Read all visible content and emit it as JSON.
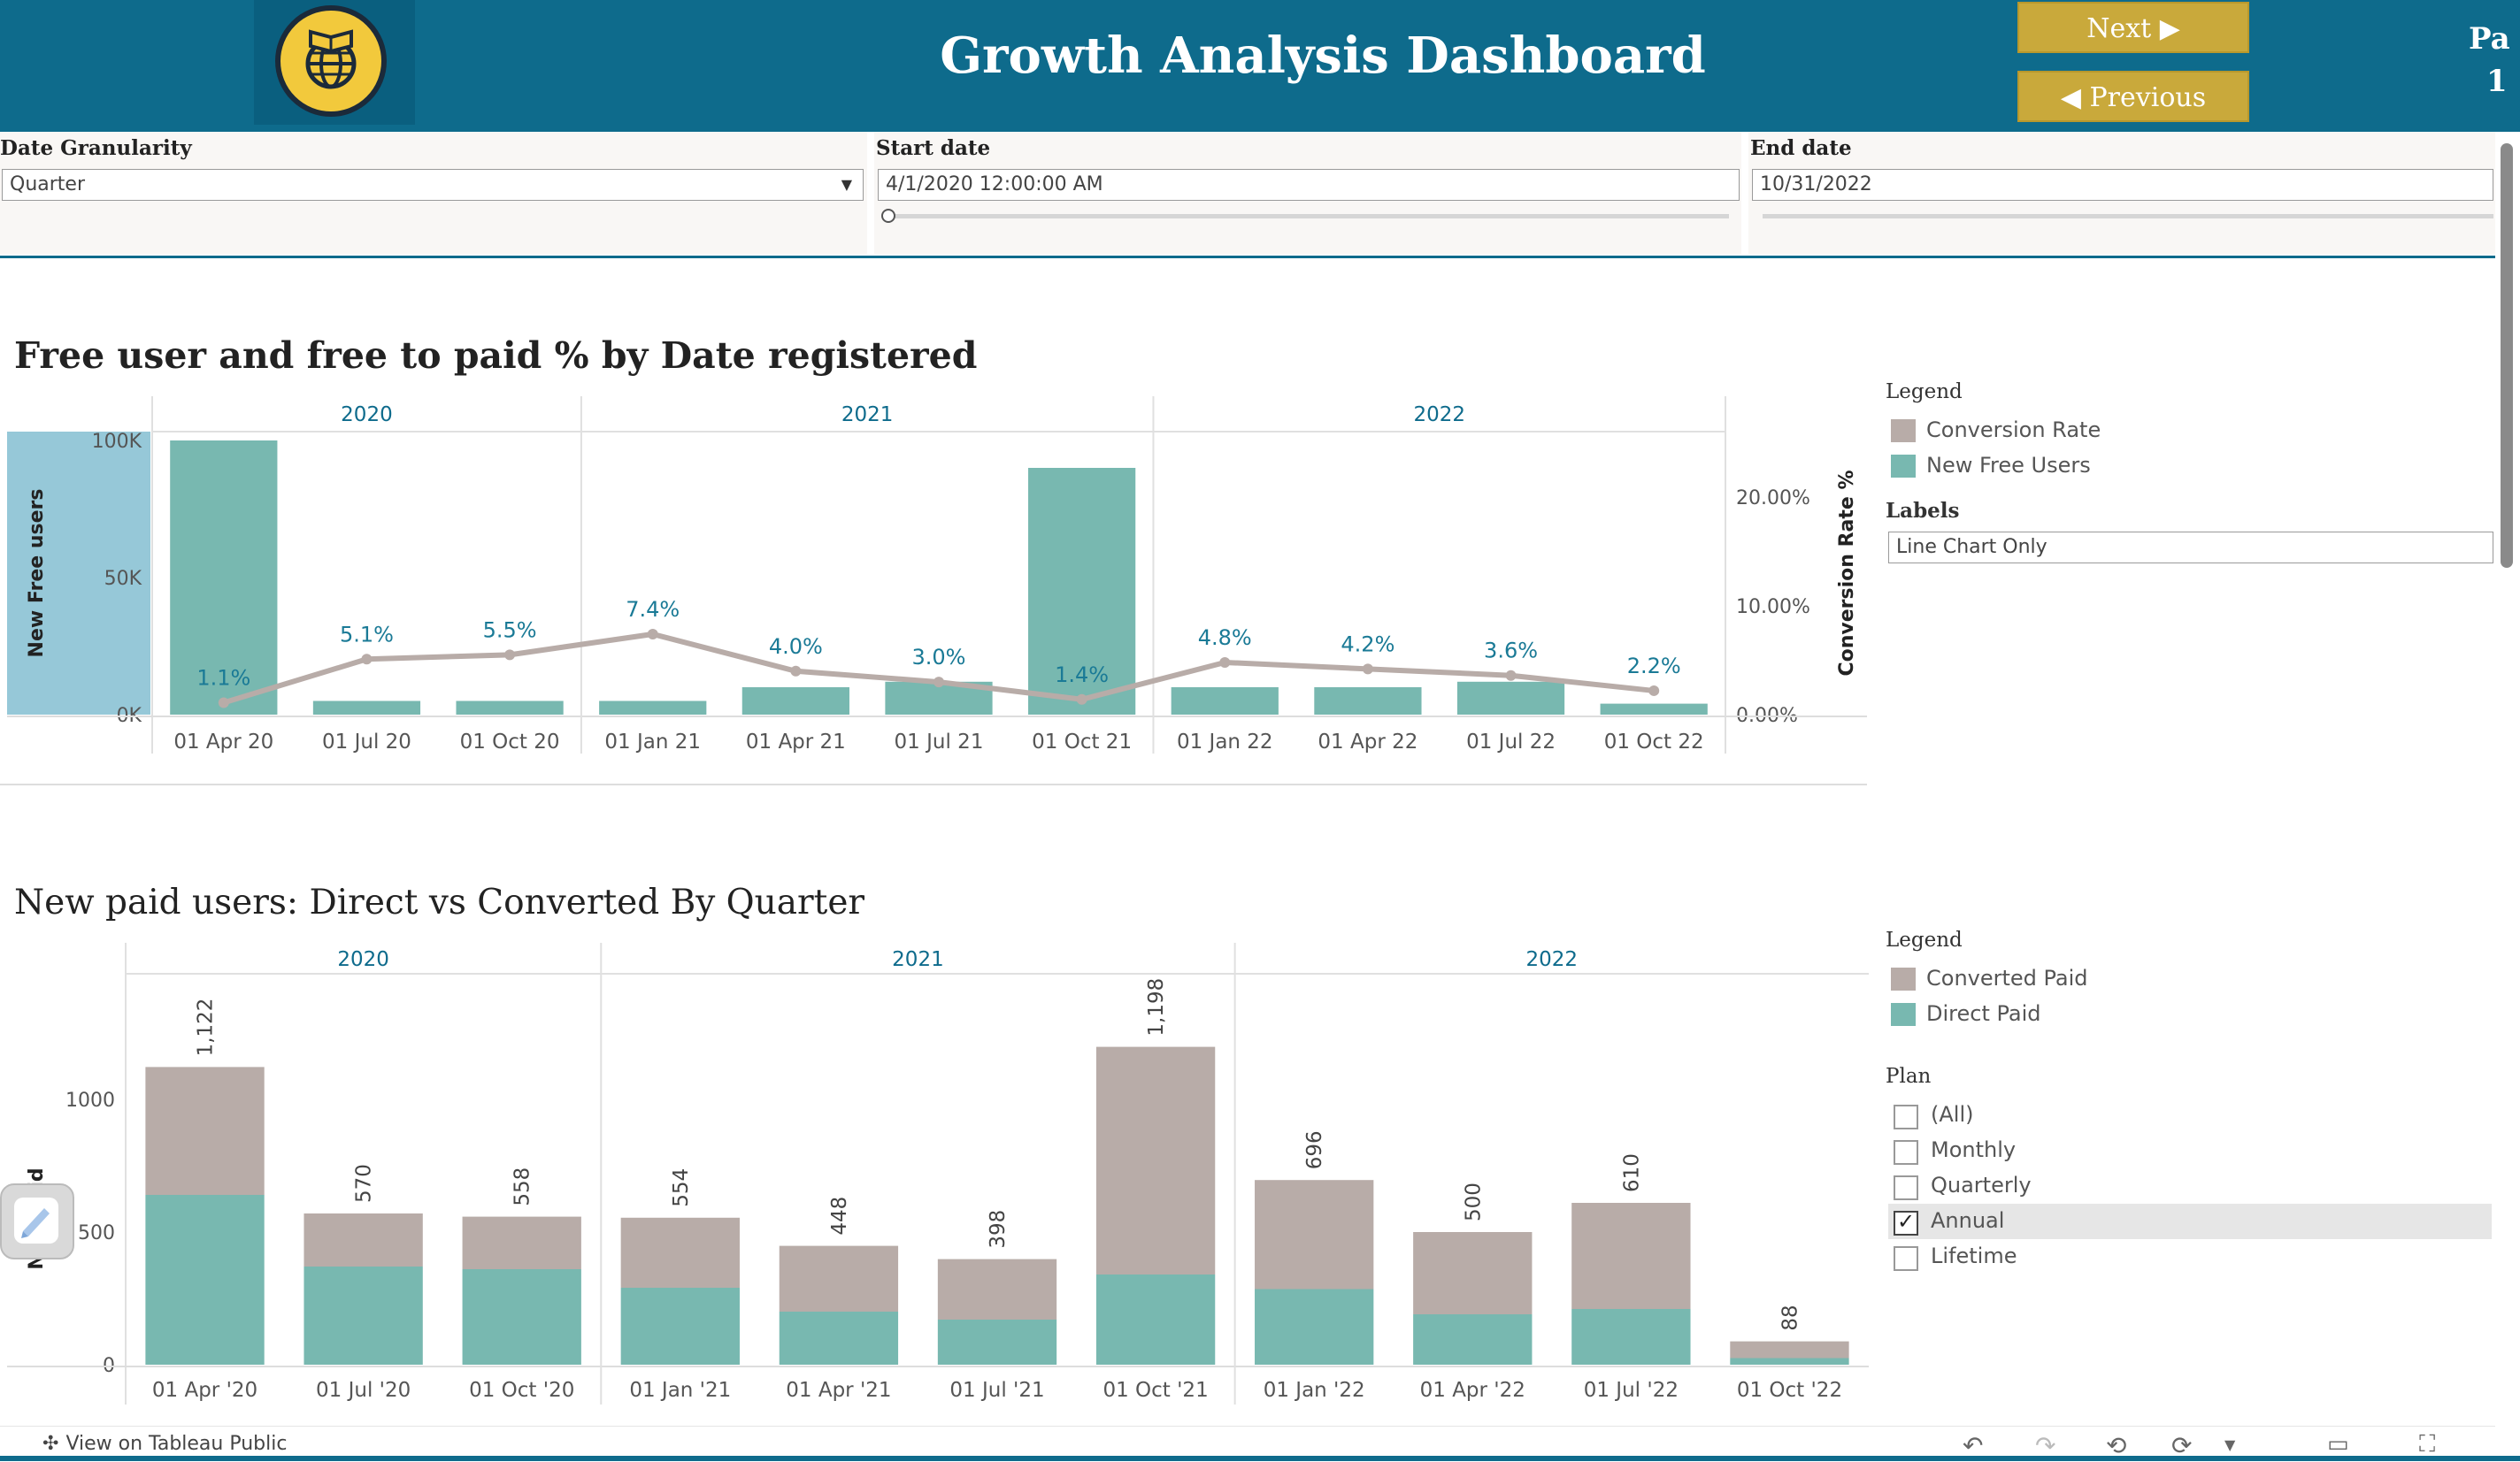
{
  "header": {
    "title": "Growth Analysis Dashboard",
    "next_label": "Next ▶",
    "previous_label": "◀ Previous",
    "page_label": "Pa",
    "page_number": "1"
  },
  "filters": {
    "granularity": {
      "label": "Date Granularity",
      "value": "Quarter"
    },
    "start_date": {
      "label": "Start date",
      "value": "4/1/2020 12:00:00 AM"
    },
    "end_date": {
      "label": "End  date",
      "value": "10/31/2022"
    }
  },
  "chart1": {
    "title": "Free user and free to paid % by Date registered",
    "legend": {
      "title": "Legend",
      "items": [
        {
          "label": "Conversion Rate",
          "color": "#b8aca8"
        },
        {
          "label": "New Free Users",
          "color": "#78b8b0"
        }
      ]
    },
    "labels_filter": {
      "label": "Labels",
      "value": "Line Chart Only"
    }
  },
  "chart2": {
    "title": "New paid users: Direct vs Converted By Quarter",
    "legend": {
      "title": "Legend",
      "items": [
        {
          "label": "Converted Paid",
          "color": "#b8aca8"
        },
        {
          "label": "Direct Paid",
          "color": "#78b8b0"
        }
      ]
    },
    "plan": {
      "title": "Plan",
      "options": [
        {
          "label": "(All)",
          "checked": false
        },
        {
          "label": "Monthly",
          "checked": false
        },
        {
          "label": "Quarterly",
          "checked": false
        },
        {
          "label": "Annual",
          "checked": true
        },
        {
          "label": "Lifetime",
          "checked": false
        }
      ]
    }
  },
  "footer": {
    "view_label": "View on Tableau Public"
  },
  "chart_data": [
    {
      "type": "bar",
      "title": "Free user and free to paid % by Date registered",
      "groups": [
        "2020",
        "2021",
        "2022"
      ],
      "categories": [
        "01 Apr 20",
        "01 Jul 20",
        "01 Oct 20",
        "01 Jan 21",
        "01 Apr 21",
        "01 Jul 21",
        "01 Oct 21",
        "01 Jan 22",
        "01 Apr 22",
        "01 Jul 22",
        "01 Oct 22"
      ],
      "group_of": [
        0,
        0,
        0,
        1,
        1,
        1,
        1,
        2,
        2,
        2,
        2
      ],
      "ylabel": "New Free users",
      "y2label": "Conversion Rate %",
      "yticks": [
        "0K",
        "50K",
        "100K"
      ],
      "y2ticks": [
        "0.00%",
        "10.00%",
        "20.00%"
      ],
      "ylim": [
        0,
        100000
      ],
      "y2lim": [
        0,
        20
      ],
      "series": [
        {
          "name": "New Free Users",
          "kind": "bar",
          "color": "#78b8b0",
          "values": [
            100000,
            5000,
            5000,
            5000,
            10000,
            12000,
            90000,
            10000,
            10000,
            12000,
            4000
          ]
        },
        {
          "name": "Conversion Rate",
          "kind": "line",
          "color": "#b8aca8",
          "values": [
            1.1,
            5.1,
            5.5,
            7.4,
            4.0,
            3.0,
            1.4,
            4.8,
            4.2,
            3.6,
            2.2
          ],
          "labels": [
            "1.1%",
            "5.1%",
            "5.5%",
            "7.4%",
            "4.0%",
            "3.0%",
            "1.4%",
            "4.8%",
            "4.2%",
            "3.6%",
            "2.2%"
          ]
        }
      ]
    },
    {
      "type": "bar",
      "stacked": true,
      "title": "New paid users: Direct vs Converted By Quarter",
      "groups": [
        "2020",
        "2021",
        "2022"
      ],
      "categories": [
        "01 Apr '20",
        "01 Jul '20",
        "01 Oct '20",
        "01 Jan '21",
        "01 Apr '21",
        "01 Jul '21",
        "01 Oct '21",
        "01 Jan '22",
        "01 Apr '22",
        "01 Jul '22",
        "01 Oct '22"
      ],
      "group_of": [
        0,
        0,
        0,
        1,
        1,
        1,
        1,
        2,
        2,
        2,
        2
      ],
      "ylabel": "New paid",
      "yticks": [
        "0",
        "500",
        "1000"
      ],
      "ylim": [
        0,
        1450
      ],
      "totals": [
        "1,122",
        "570",
        "558",
        "554",
        "448",
        "398",
        "1,198",
        "696",
        "500",
        "610",
        "88"
      ],
      "series": [
        {
          "name": "Direct Paid",
          "color": "#78b8b0",
          "values": [
            640,
            370,
            360,
            290,
            200,
            170,
            340,
            285,
            190,
            210,
            25
          ]
        },
        {
          "name": "Converted Paid",
          "color": "#b8aca8",
          "values": [
            482,
            200,
            198,
            264,
            248,
            228,
            858,
            411,
            310,
            400,
            63
          ]
        }
      ]
    }
  ]
}
